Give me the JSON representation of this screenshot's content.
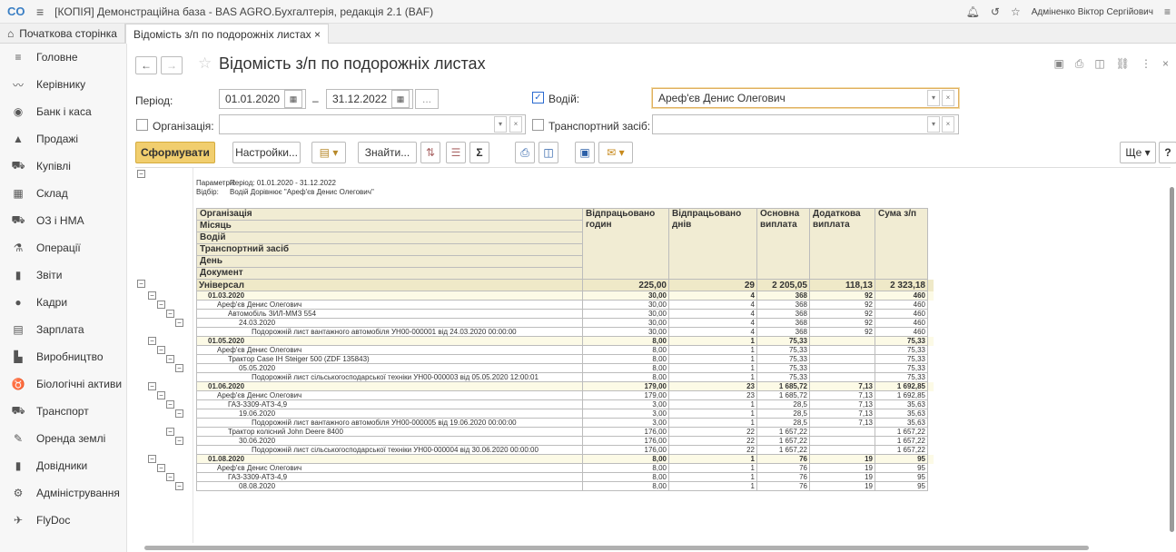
{
  "titlebar": {
    "app_title": "[КОПІЯ] Демонстраційна база - BAS AGRO.Бухгалтерія, редакція 2.1  (BAF)",
    "user": "Адміненко Віктор Сергійович"
  },
  "tabs": [
    {
      "label": "Початкова сторінка"
    },
    {
      "label": "Відомість з/п по подорожніх листах ×"
    }
  ],
  "sidebar": {
    "items": [
      {
        "label": "Головне",
        "icon": "menu-lines-icon"
      },
      {
        "label": "Керівнику",
        "icon": "trend-icon"
      },
      {
        "label": "Банк і каса",
        "icon": "coin-icon"
      },
      {
        "label": "Продажі",
        "icon": "bag-icon"
      },
      {
        "label": "Купівлі",
        "icon": "cart-icon"
      },
      {
        "label": "Склад",
        "icon": "grid-icon"
      },
      {
        "label": "ОЗ і НМА",
        "icon": "truck-icon"
      },
      {
        "label": "Операції",
        "icon": "operations-icon"
      },
      {
        "label": "Звіти",
        "icon": "bars-icon"
      },
      {
        "label": "Кадри",
        "icon": "person-icon"
      },
      {
        "label": "Зарплата",
        "icon": "calculator-icon"
      },
      {
        "label": "Виробництво",
        "icon": "factory-icon"
      },
      {
        "label": "Біологічні активи",
        "icon": "cow-icon"
      },
      {
        "label": "Транспорт",
        "icon": "tractor-icon"
      },
      {
        "label": "Оренда землі",
        "icon": "feather-icon"
      },
      {
        "label": "Довідники",
        "icon": "book-icon"
      },
      {
        "label": "Адміністрування",
        "icon": "gear-icon"
      },
      {
        "label": "FlyDoc",
        "icon": "flydoc-icon"
      }
    ]
  },
  "page": {
    "title": "Відомість з/п по подорожніх листах"
  },
  "form": {
    "period_label": "Період:",
    "date_from": "01.01.2020",
    "dash": "–",
    "date_to": "31.12.2022",
    "ellipsis": "...",
    "driver_label": "Водій:",
    "driver_value": "Ареф'єв Денис Олегович",
    "driver_checked": true,
    "org_label": "Організація:",
    "org_value": "",
    "vehicle_label": "Транспортний засіб:",
    "vehicle_value": ""
  },
  "toolbar": {
    "generate": "Сформувати",
    "settings": "Настройки...",
    "find": "Знайти...",
    "more": "Ще",
    "help": "?"
  },
  "report": {
    "params_label": "Параметри:",
    "params_value": "Період: 01.01.2020 - 31.12.2022",
    "filter_label": "Відбір:",
    "filter_value": "Водій Дорівнює \"Ареф'єв Денис Олегович\"",
    "group_headers": [
      "Організація",
      "Місяць",
      "Водій",
      "Транспортний засіб",
      "День",
      "Документ"
    ],
    "col_headers": [
      "Відпрацьовано годин",
      "Відпрацьовано днів",
      "Основна виплата",
      "Додаткова виплата",
      "Сума з/п"
    ],
    "rows": [
      {
        "level": 0,
        "name": "Універсал",
        "vals": [
          "225,00",
          "29",
          "2 205,05",
          "118,13",
          "2 323,18"
        ]
      },
      {
        "level": 1,
        "name": "01.03.2020",
        "vals": [
          "30,00",
          "4",
          "368",
          "92",
          "460"
        ]
      },
      {
        "level": 2,
        "name": "Ареф'єв Денис Олегович",
        "vals": [
          "30,00",
          "4",
          "368",
          "92",
          "460"
        ]
      },
      {
        "level": 3,
        "name": "Автомобіль ЗИЛ-ММЗ 554",
        "vals": [
          "30,00",
          "4",
          "368",
          "92",
          "460"
        ]
      },
      {
        "level": 4,
        "name": "24.03.2020",
        "vals": [
          "30,00",
          "4",
          "368",
          "92",
          "460"
        ]
      },
      {
        "level": 5,
        "name": "Подорожній лист вантажного автомобіля УН00-000001 від 24.03.2020 00:00:00",
        "vals": [
          "30,00",
          "4",
          "368",
          "92",
          "460"
        ]
      },
      {
        "level": 1,
        "name": "01.05.2020",
        "vals": [
          "8,00",
          "1",
          "75,33",
          "",
          "75,33"
        ]
      },
      {
        "level": 2,
        "name": "Ареф'єв Денис Олегович",
        "vals": [
          "8,00",
          "1",
          "75,33",
          "",
          "75,33"
        ]
      },
      {
        "level": 3,
        "name": "Трактор Case IH Steiger 500 (ZDF 135843)",
        "vals": [
          "8,00",
          "1",
          "75,33",
          "",
          "75,33"
        ]
      },
      {
        "level": 4,
        "name": "05.05.2020",
        "vals": [
          "8,00",
          "1",
          "75,33",
          "",
          "75,33"
        ]
      },
      {
        "level": 5,
        "name": "Подорожній лист сільськогосподарської техніки УН00-000003 від 05.05.2020 12:00:01",
        "vals": [
          "8,00",
          "1",
          "75,33",
          "",
          "75,33"
        ]
      },
      {
        "level": 1,
        "name": "01.06.2020",
        "vals": [
          "179,00",
          "23",
          "1 685,72",
          "7,13",
          "1 692,85"
        ]
      },
      {
        "level": 2,
        "name": "Ареф'єв Денис Олегович",
        "vals": [
          "179,00",
          "23",
          "1 685,72",
          "7,13",
          "1 692,85"
        ]
      },
      {
        "level": 3,
        "name": "ГАЗ-3309-АТЗ-4,9",
        "vals": [
          "3,00",
          "1",
          "28,5",
          "7,13",
          "35,63"
        ]
      },
      {
        "level": 4,
        "name": "19.06.2020",
        "vals": [
          "3,00",
          "1",
          "28,5",
          "7,13",
          "35,63"
        ]
      },
      {
        "level": 5,
        "name": "Подорожній лист вантажного автомобіля УН00-000005 від 19.06.2020 00:00:00",
        "vals": [
          "3,00",
          "1",
          "28,5",
          "7,13",
          "35,63"
        ]
      },
      {
        "level": 3,
        "name": "Трактор колісний John Deere 8400",
        "vals": [
          "176,00",
          "22",
          "1 657,22",
          "",
          "1 657,22"
        ]
      },
      {
        "level": 4,
        "name": "30.06.2020",
        "vals": [
          "176,00",
          "22",
          "1 657,22",
          "",
          "1 657,22"
        ]
      },
      {
        "level": 5,
        "name": "Подорожній лист сільськогосподарської техніки УН00-000004 від 30.06.2020 00:00:00",
        "vals": [
          "176,00",
          "22",
          "1 657,22",
          "",
          "1 657,22"
        ]
      },
      {
        "level": 1,
        "name": "01.08.2020",
        "vals": [
          "8,00",
          "1",
          "76",
          "19",
          "95"
        ]
      },
      {
        "level": 2,
        "name": "Ареф'єв Денис Олегович",
        "vals": [
          "8,00",
          "1",
          "76",
          "19",
          "95"
        ]
      },
      {
        "level": 3,
        "name": "ГАЗ-3309-АТЗ-4,9",
        "vals": [
          "8,00",
          "1",
          "76",
          "19",
          "95"
        ]
      },
      {
        "level": 4,
        "name": "08.08.2020",
        "vals": [
          "8,00",
          "1",
          "76",
          "19",
          "95"
        ]
      }
    ]
  }
}
